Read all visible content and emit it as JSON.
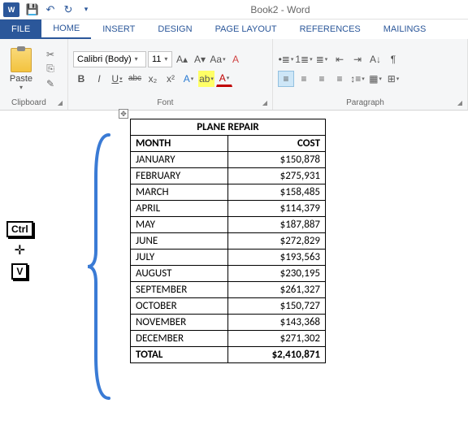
{
  "titlebar": {
    "doc_title": "Book2 - Word",
    "app_abbr": "W"
  },
  "qat": {
    "save": "💾",
    "undo": "↶",
    "redo": "↻",
    "more": "▾"
  },
  "tabs": {
    "file": "FILE",
    "home": "HOME",
    "insert": "INSERT",
    "design": "DESIGN",
    "page_layout": "PAGE LAYOUT",
    "references": "REFERENCES",
    "mailings": "MAILINGS"
  },
  "ribbon": {
    "clipboard": {
      "label": "Clipboard",
      "paste": "Paste"
    },
    "font": {
      "label": "Font",
      "name": "Calibri (Body)",
      "size": "11",
      "bold": "B",
      "italic": "I",
      "underline": "U",
      "strike": "abc",
      "sub": "x₂",
      "sup": "x²",
      "grow": "A▴",
      "shrink": "A▾",
      "case": "Aa",
      "clear": "A",
      "effects": "A",
      "highlight": "ab",
      "color": "A"
    },
    "paragraph": {
      "label": "Paragraph",
      "bullets": "•≣",
      "numbers": "1≣",
      "multilevel": "≣",
      "dec_indent": "⇤",
      "inc_indent": "⇥",
      "sort": "A↓",
      "pilcrow": "¶",
      "align_l": "≡",
      "align_c": "≡",
      "align_r": "≡",
      "align_j": "≡",
      "spacing": "↕≡",
      "shading": "▦",
      "borders": "⊞"
    }
  },
  "keys": {
    "ctrl": "Ctrl",
    "plus": "✛",
    "v": "V"
  },
  "table": {
    "title": "PLANE REPAIR",
    "col_month": "MONTH",
    "col_cost": "COST",
    "rows": [
      {
        "m": "JANUARY",
        "c": "$150,878"
      },
      {
        "m": "FEBRUARY",
        "c": "$275,931"
      },
      {
        "m": "MARCH",
        "c": "$158,485"
      },
      {
        "m": "APRIL",
        "c": "$114,379"
      },
      {
        "m": "MAY",
        "c": "$187,887"
      },
      {
        "m": "JUNE",
        "c": "$272,829"
      },
      {
        "m": "JULY",
        "c": "$193,563"
      },
      {
        "m": "AUGUST",
        "c": "$230,195"
      },
      {
        "m": "SEPTEMBER",
        "c": "$261,327"
      },
      {
        "m": "OCTOBER",
        "c": "$150,727"
      },
      {
        "m": "NOVEMBER",
        "c": "$143,368"
      },
      {
        "m": "DECEMBER",
        "c": "$271,302"
      }
    ],
    "total_label": "TOTAL",
    "total_value": "$2,410,871"
  }
}
